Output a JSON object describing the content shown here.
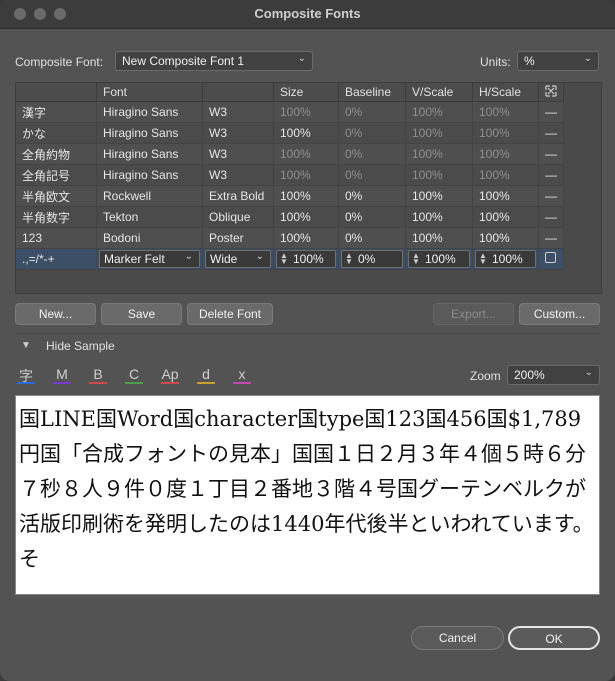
{
  "window": {
    "title": "Composite Fonts"
  },
  "composite_font": {
    "label": "Composite Font:",
    "value": "New Composite Font 1"
  },
  "units": {
    "label": "Units:",
    "value": "%"
  },
  "table": {
    "headers": [
      "",
      "Font",
      "",
      "Size",
      "Baseline",
      "V/Scale",
      "H/Scale"
    ],
    "scale_icon": "scale-to-fit-icon",
    "rows": [
      {
        "name": "漢字",
        "font": "Hiragino Sans",
        "style": "W3",
        "size": "100%",
        "baseline": "0%",
        "vscale": "100%",
        "hscale": "100%",
        "mark": "—"
      },
      {
        "name": "かな",
        "font": "Hiragino Sans",
        "style": "W3",
        "size": "100%",
        "baseline": "0%",
        "vscale": "100%",
        "hscale": "100%",
        "mark": "—"
      },
      {
        "name": "全角約物",
        "font": "Hiragino Sans",
        "style": "W3",
        "size": "100%",
        "baseline": "0%",
        "vscale": "100%",
        "hscale": "100%",
        "mark": "—"
      },
      {
        "name": "全角記号",
        "font": "Hiragino Sans",
        "style": "W3",
        "size": "100%",
        "baseline": "0%",
        "vscale": "100%",
        "hscale": "100%",
        "mark": "—"
      },
      {
        "name": "半角欧文",
        "font": "Rockwell",
        "style": "Extra Bold",
        "size": "100%",
        "baseline": "0%",
        "vscale": "100%",
        "hscale": "100%",
        "mark": "—"
      },
      {
        "name": "半角数字",
        "font": "Tekton",
        "style": "Oblique",
        "size": "100%",
        "baseline": "0%",
        "vscale": "100%",
        "hscale": "100%",
        "mark": "—"
      },
      {
        "name": "123",
        "font": "Bodoni",
        "style": "Poster",
        "size": "100%",
        "baseline": "0%",
        "vscale": "100%",
        "hscale": "100%",
        "mark": "—"
      }
    ],
    "selected": {
      "name": ".,=/*-+",
      "font": "Marker Felt",
      "style": "Wide",
      "size": "100%",
      "baseline": "0%",
      "vscale": "100%",
      "hscale": "100%"
    }
  },
  "buttons": {
    "new": "New...",
    "save": "Save",
    "delete": "Delete Font",
    "export": "Export...",
    "custom": "Custom...",
    "cancel": "Cancel",
    "ok": "OK"
  },
  "sample": {
    "toggle_label": "Hide Sample",
    "zoom_label": "Zoom",
    "zoom_value": "200%",
    "text": "国LINE国Word国character国type国123国456国$1,789円国「合成フォントの見本」国国１日２月３年４個５時６分７秒８人９件０度１丁目２番地３階４号国グーテンベルクが活版印刷術を発明したのは1440年代後半といわれています。そ",
    "glyph_tools": [
      {
        "char": "字",
        "color": "#2f6bd8"
      },
      {
        "char": "M",
        "color": "#7a3ad1"
      },
      {
        "char": "B",
        "color": "#d14a4a"
      },
      {
        "char": "C",
        "color": "#4aa04a"
      },
      {
        "char": "Ap",
        "color": "#d14a4a"
      },
      {
        "char": "d",
        "color": "#c9a02e"
      },
      {
        "char": "x",
        "color": "#c04ab0"
      }
    ]
  }
}
